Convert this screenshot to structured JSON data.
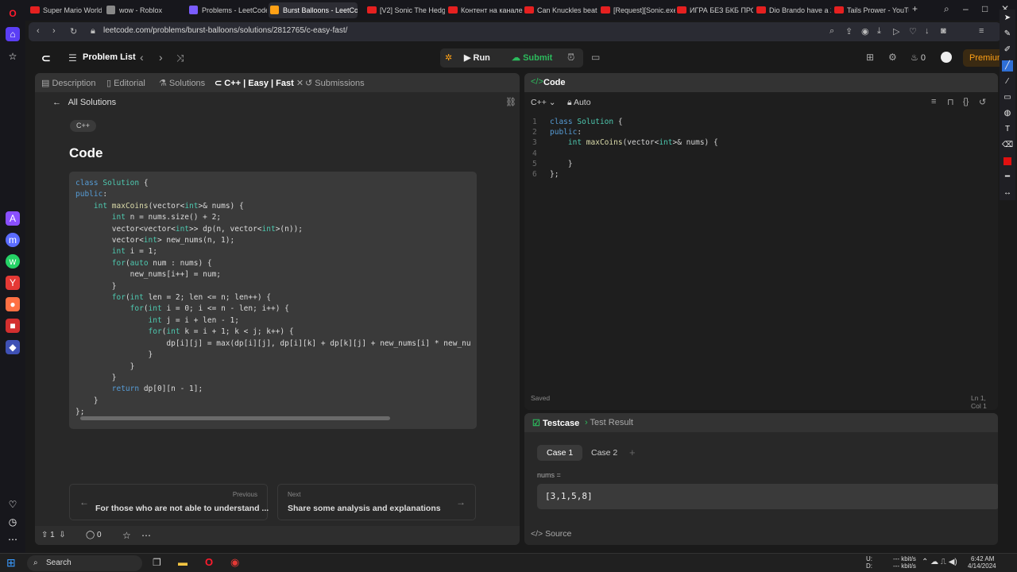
{
  "browser": {
    "tabs": [
      {
        "label": "Super Mario World 6-",
        "icon": "youtube"
      },
      {
        "label": "wow - Roblox",
        "icon": "roblox"
      },
      {
        "label": "Problems - LeetCode",
        "icon": "leetcode"
      },
      {
        "label": "Burst Balloons - LeetCode",
        "icon": "leetcode",
        "active": true
      },
      {
        "label": "[V2] Sonic The Hedge",
        "icon": "youtube"
      },
      {
        "label": "Контент на канале",
        "icon": "youtube"
      },
      {
        "label": "Can Knuckles beat So",
        "icon": "youtube"
      },
      {
        "label": "[Request][Sonic.exe][",
        "icon": "youtube"
      },
      {
        "label": "ИГРА БЕЗ БКБ ПРОТ",
        "icon": "youtube"
      },
      {
        "label": "Dio Brando have a 2",
        "icon": "youtube"
      },
      {
        "label": "Tails Prower - YouTub",
        "icon": "youtube"
      }
    ],
    "url": "leetcode.com/problems/burst-balloons/solutions/2812765/c-easy-fast/"
  },
  "lc_nav": {
    "problem_list": "Problem List",
    "run": "Run",
    "submit": "Submit",
    "streak": "0",
    "premium": "Premium"
  },
  "left_panel": {
    "tabs": [
      "Description",
      "Editorial",
      "Solutions",
      "C++ | Easy | Fast",
      "Submissions"
    ],
    "all_solutions": "All Solutions",
    "lang_tag": "C++",
    "heading": "Code",
    "code_lines": [
      "class Solution {",
      "public:",
      "    int maxCoins(vector<int>& nums) {",
      "        int n = nums.size() + 2;",
      "        vector<vector<int>> dp(n, vector<int>(n));",
      "        vector<int> new_nums(n, 1);",
      "        int i = 1;",
      "        for(auto num : nums) {",
      "            new_nums[i++] = num;",
      "        }",
      "        for(int len = 2; len <= n; len++) {",
      "            for(int i = 0; i <= n - len; i++) {",
      "                int j = i + len - 1;",
      "                for(int k = i + 1; k < j; k++) {",
      "                    dp[i][j] = max(dp[i][j], dp[i][k] + dp[k][j] + new_nums[i] * new_nu",
      "                }",
      "            }",
      "        }",
      "        return dp[0][n - 1];",
      "    }",
      "};"
    ],
    "prev_label": "Previous",
    "prev_title": "For those who are not able to understand ...",
    "next_label": "Next",
    "next_title": "Share some analysis and explanations",
    "upvotes": "1",
    "comments": "0"
  },
  "code_panel": {
    "title": "Code",
    "language": "C++",
    "mode": "Auto",
    "lines": [
      "class Solution {",
      "public:",
      "    int maxCoins(vector<int>& nums) {",
      "",
      "    }",
      "};"
    ],
    "status": "Saved",
    "cursor": "Ln 1, Col 1"
  },
  "test_panel": {
    "tab_testcase": "Testcase",
    "tab_result": "Test Result",
    "cases": [
      "Case 1",
      "Case 2"
    ],
    "var_label": "nums =",
    "var_value": "[3,1,5,8]",
    "source": "Source"
  },
  "taskbar": {
    "search": "Search",
    "net_up": "U:",
    "net_down": "D:",
    "rate_up": "--- kbit/s",
    "rate_down": "--- kbit/s",
    "time": "6:42 AM",
    "date": "4/14/2024"
  }
}
